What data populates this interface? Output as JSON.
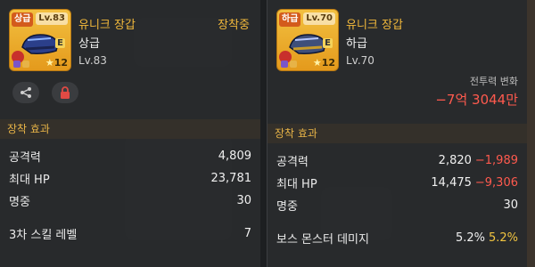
{
  "left": {
    "item": {
      "grade_tag": "상급",
      "level_tag": "Lv.83",
      "e_badge": "E",
      "stars": "12",
      "name": "유니크 장갑",
      "grade": "상급",
      "level": "Lv.83"
    },
    "equipped_label": "장착중",
    "section_title": "장착 효과",
    "stats": [
      {
        "label": "공격력",
        "value": "4,809"
      },
      {
        "label": "최대 HP",
        "value": "23,781"
      },
      {
        "label": "명중",
        "value": "30"
      },
      {
        "label": "3차 스킬 레벨",
        "value": "7"
      }
    ]
  },
  "right": {
    "item": {
      "grade_tag": "하급",
      "level_tag": "Lv.70",
      "e_badge": "E",
      "stars": "12",
      "name": "유니크 장갑",
      "grade": "하급",
      "level": "Lv.70"
    },
    "combat_power_label": "전투력 변화",
    "combat_power_delta": "−7억 3044만",
    "section_title": "장착 효과",
    "stats": [
      {
        "label": "공격력",
        "value": "2,820",
        "diff": "−1,989"
      },
      {
        "label": "최대 HP",
        "value": "14,475",
        "diff": "−9,306"
      },
      {
        "label": "명중",
        "value": "30",
        "diff": ""
      },
      {
        "label": "보스 몬스터 데미지",
        "value": "5.2%",
        "diff": "5.2%"
      }
    ]
  },
  "icons": {
    "share": "share-icon",
    "lock": "lock-icon",
    "star": "star-icon"
  },
  "colors": {
    "accent_gold": "#f2b93b",
    "negative": "#ff5a4e",
    "positive": "#f2c540",
    "card_gold": "#f2c040"
  }
}
